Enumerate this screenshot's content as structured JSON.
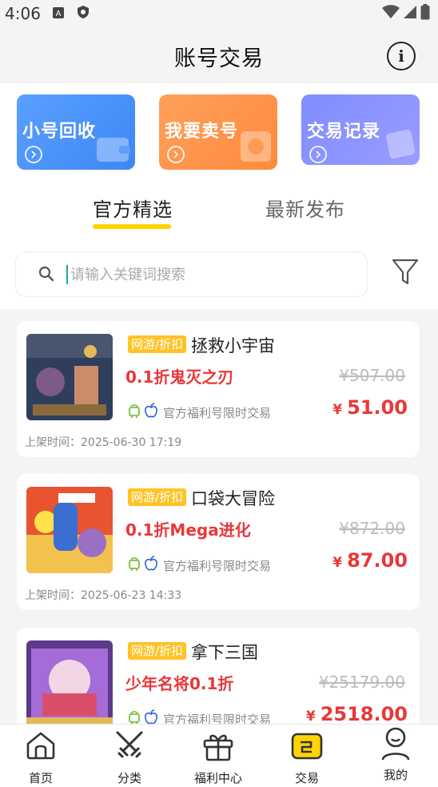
{
  "status_bar": {
    "time": "4:06"
  },
  "header": {
    "title": "账号交易"
  },
  "shortcuts": [
    {
      "label": "小号回收",
      "color": "#4a93fb"
    },
    {
      "label": "我要卖号",
      "color": "#ff963f"
    },
    {
      "label": "交易记录",
      "color": "#8a93ff"
    }
  ],
  "tabs": [
    {
      "label": "官方精选",
      "active": true
    },
    {
      "label": "最新发布",
      "active": false
    }
  ],
  "search": {
    "placeholder": "请输入关键词搜索"
  },
  "listings": [
    {
      "tag": "网游/折扣",
      "name": "拯救小宇宙",
      "promo": "0.1折鬼灭之刃",
      "old_price": "¥507.00",
      "currency": "¥",
      "price": "51.00",
      "platform_text": "官方福利号限时交易",
      "listed_time": "上架时间：2025-06-30 17:19"
    },
    {
      "tag": "网游/折扣",
      "name": "口袋大冒险",
      "promo": "0.1折Mega进化",
      "old_price": "¥872.00",
      "currency": "¥",
      "price": "87.00",
      "platform_text": "官方福利号限时交易",
      "listed_time": "上架时间：2025-06-23 14:33"
    },
    {
      "tag": "网游/折扣",
      "name": "拿下三国",
      "promo": "少年名将0.1折",
      "old_price": "¥25179.00",
      "currency": "¥",
      "price": "2518.00",
      "platform_text": "官方福利号限时交易",
      "listed_time": ""
    }
  ],
  "bottom_nav": [
    {
      "label": "首页",
      "icon": "home-icon"
    },
    {
      "label": "分类",
      "icon": "swords-icon"
    },
    {
      "label": "福利中心",
      "icon": "gift-icon"
    },
    {
      "label": "交易",
      "icon": "trade-icon",
      "active": true
    },
    {
      "label": "我的",
      "icon": "profile-icon"
    }
  ],
  "colors": {
    "accent_red": "#e8383a",
    "tab_underline": "#ffd400",
    "tag_bg": "#ffc325"
  }
}
